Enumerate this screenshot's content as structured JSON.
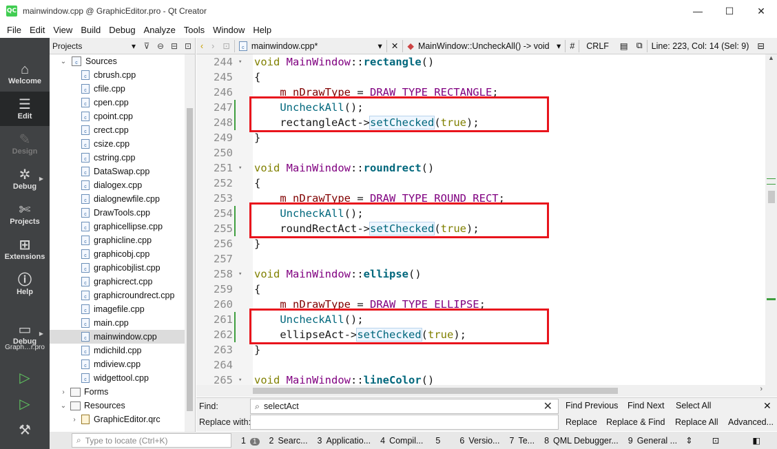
{
  "window": {
    "app_icon": "QC",
    "title": "mainwindow.cpp @ GraphicEditor.pro - Qt Creator",
    "minimize": "—",
    "maximize": "☐",
    "close": "✕"
  },
  "menu": [
    "File",
    "Edit",
    "View",
    "Build",
    "Debug",
    "Analyze",
    "Tools",
    "Window",
    "Help"
  ],
  "modes": [
    {
      "label": "Welcome",
      "icon": "home-icon"
    },
    {
      "label": "Edit",
      "icon": "edit-icon"
    },
    {
      "label": "Design",
      "icon": "design-icon"
    },
    {
      "label": "Debug",
      "icon": "bug-icon"
    },
    {
      "label": "Projects",
      "icon": "wrench-icon"
    },
    {
      "label": "Extensions",
      "icon": "extensions-icon"
    },
    {
      "label": "Help",
      "icon": "help-icon"
    }
  ],
  "project_target": {
    "name": "Graph…r.pro",
    "mode": "Debug"
  },
  "sidebar": {
    "selector": "Projects",
    "sources_label": "Sources",
    "files": [
      "cbrush.cpp",
      "cfile.cpp",
      "cpen.cpp",
      "cpoint.cpp",
      "crect.cpp",
      "csize.cpp",
      "cstring.cpp",
      "DataSwap.cpp",
      "dialogex.cpp",
      "dialognewfile.cpp",
      "DrawTools.cpp",
      "graphicellipse.cpp",
      "graphicline.cpp",
      "graphicobj.cpp",
      "graphicobjlist.cpp",
      "graphicrect.cpp",
      "graphicroundrect.cpp",
      "imagefile.cpp",
      "main.cpp",
      "mainwindow.cpp",
      "mdichild.cpp",
      "mdiview.cpp",
      "widgettool.cpp"
    ],
    "selected_file": "mainwindow.cpp",
    "forms_label": "Forms",
    "resources_label": "Resources",
    "qrc_label": "GraphicEditor.qrc"
  },
  "editor_toolbar": {
    "file": "mainwindow.cpp*",
    "symbol": "MainWindow::UncheckAll() -> void",
    "hash": "#",
    "line_ending": "CRLF",
    "position": "Line: 223, Col: 14 (Sel: 9)"
  },
  "code_lines": [
    {
      "n": "244",
      "fold": true
    },
    {
      "n": "245"
    },
    {
      "n": "246"
    },
    {
      "n": "247",
      "changed": true
    },
    {
      "n": "248",
      "changed": true
    },
    {
      "n": "249"
    },
    {
      "n": "250"
    },
    {
      "n": "251",
      "fold": true
    },
    {
      "n": "252"
    },
    {
      "n": "253"
    },
    {
      "n": "254",
      "changed": true
    },
    {
      "n": "255",
      "changed": true
    },
    {
      "n": "256"
    },
    {
      "n": "257"
    },
    {
      "n": "258",
      "fold": true
    },
    {
      "n": "259"
    },
    {
      "n": "260"
    },
    {
      "n": "261",
      "changed": true
    },
    {
      "n": "262",
      "changed": true
    },
    {
      "n": "263"
    },
    {
      "n": "264"
    },
    {
      "n": "265",
      "fold": true
    }
  ],
  "code": {
    "void": "void",
    "cls": "MainWindow",
    "sep": "::",
    "rectangle": "rectangle",
    "roundrect": "roundrect",
    "ellipse": "ellipse",
    "lineColor": "lineColor",
    "parens": "()",
    "open": "{",
    "close": "}",
    "member": "m_nDrawType",
    "assign": " = ",
    "semi": ";",
    "e_rect": "DRAW_TYPE_RECTANGLE",
    "e_round": "DRAW_TYPE_ROUND_RECT",
    "e_ellipse": "DRAW_TYPE_ELLIPSE",
    "uncheck": "UncheckAll",
    "call_end": "();",
    "rect_act": "rectangleAct",
    "round_act": "roundRectAct",
    "ellipse_act": "ellipseAct",
    "arrow": "->",
    "set_checked": "setChecked",
    "lp": "(",
    "true": "true",
    "rp_semi": ");"
  },
  "findbar": {
    "find_label": "Find:",
    "find_value": "selectAct",
    "replace_label": "Replace with:",
    "replace_value": "",
    "find_previous": "Find Previous",
    "find_next": "Find Next",
    "select_all": "Select All",
    "replace": "Replace",
    "replace_find": "Replace & Find",
    "replace_all": "Replace All",
    "advanced": "Advanced..."
  },
  "statusbar": {
    "locate_placeholder": "Type to locate (Ctrl+K)",
    "panes": [
      {
        "num": "1",
        "label": "Issues-badge",
        "text": "1"
      },
      {
        "num": "2",
        "text": "Searc..."
      },
      {
        "num": "3",
        "text": "Applicatio..."
      },
      {
        "num": "4",
        "text": "Compil..."
      },
      {
        "num": "5",
        "text": ""
      },
      {
        "num": "6",
        "text": "Versio..."
      },
      {
        "num": "7",
        "text": "Te..."
      },
      {
        "num": "8",
        "text": "QML Debugger..."
      },
      {
        "num": "9",
        "text": "General ..."
      }
    ]
  },
  "colors": {
    "modebar": "#404244",
    "highlight_box": "#e8141c",
    "keyword": "#808000",
    "function": "#00677c",
    "class": "#800080"
  }
}
